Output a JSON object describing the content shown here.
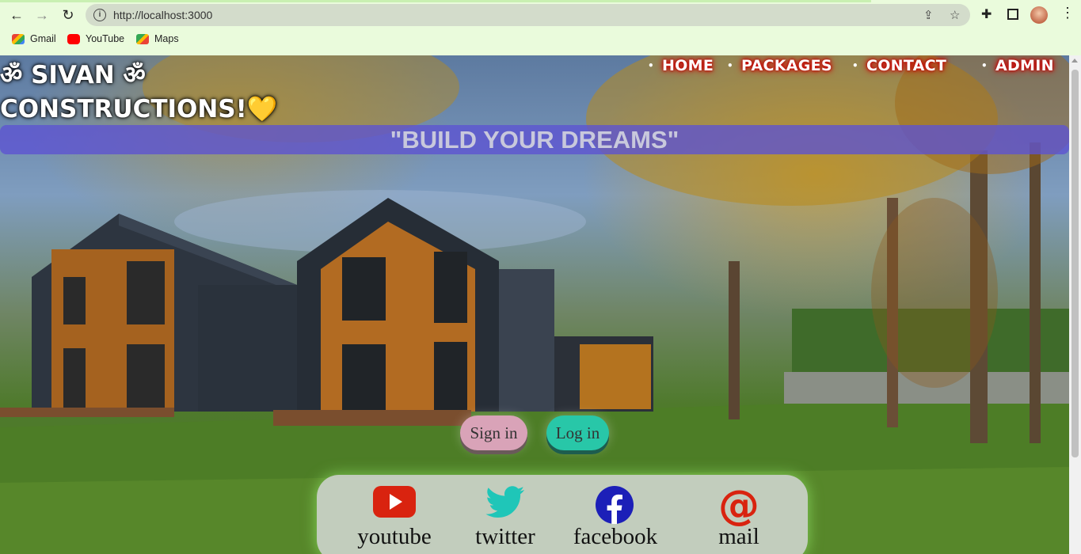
{
  "browser": {
    "url": "http://localhost:3000",
    "bookmarks": [
      {
        "label": "Gmail",
        "icon": "gmail-icon"
      },
      {
        "label": "YouTube",
        "icon": "youtube-icon"
      },
      {
        "label": "Maps",
        "icon": "maps-icon"
      }
    ]
  },
  "site": {
    "logo_line1": "ॐ SIVAN ॐ",
    "logo_line2": "CONSTRUCTIONS!",
    "logo_heart": "💛",
    "nav": [
      {
        "label": "HOME"
      },
      {
        "label": "PACKAGES"
      },
      {
        "label": "CONTACT"
      },
      {
        "label": "ADMIN"
      }
    ],
    "tagline": "\"BUILD YOUR DREAMS\"",
    "signin_label": "Sign in",
    "login_label": "Log in",
    "social": [
      {
        "label": "youtube",
        "icon": "youtube-icon",
        "color": "#d9230f"
      },
      {
        "label": "twitter",
        "icon": "twitter-icon",
        "color": "#1fc6b8"
      },
      {
        "label": "facebook",
        "icon": "facebook-icon",
        "color": "#1c1fb8"
      },
      {
        "label": "mail",
        "icon": "at-sign-icon",
        "color": "#d9230f"
      }
    ]
  },
  "colors": {
    "tagline_bg": "#5c52d2",
    "signin_bg": "#d9a3b8",
    "login_bg": "#28c7a8",
    "nav_glow": "#cc0000"
  }
}
